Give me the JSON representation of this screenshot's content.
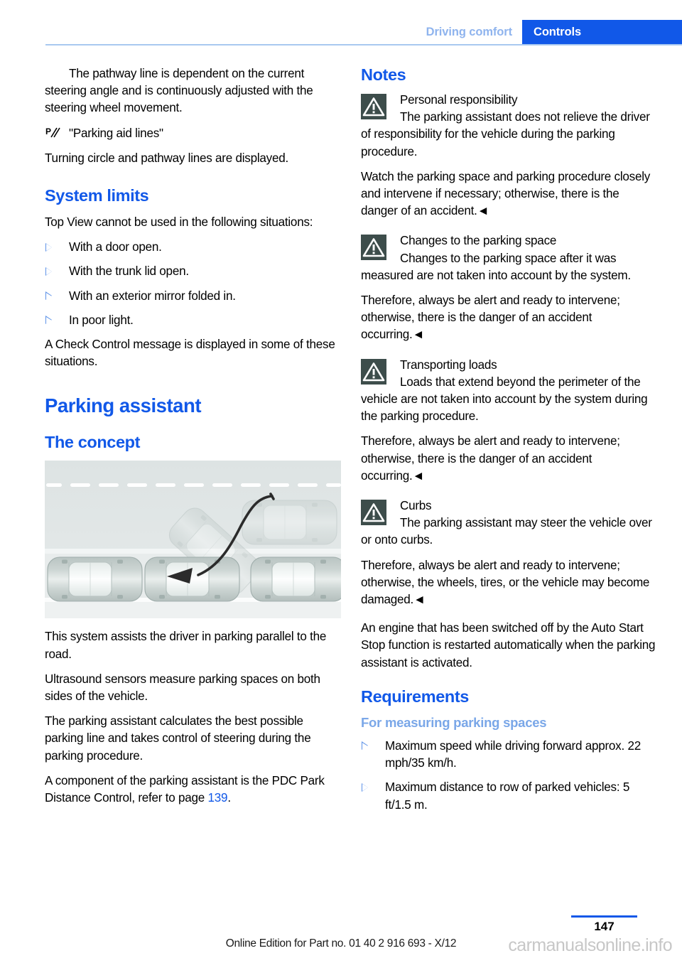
{
  "header": {
    "inactive_tab": "Driving comfort",
    "active_tab": "Controls"
  },
  "left_column": {
    "intro_paragraph": "The pathway line is dependent on the current steering angle and is continuously adjusted with the steering wheel movement.",
    "parking_aid_lines_label": "\"Parking aid lines\"",
    "parking_aid_lines_desc": "Turning circle and pathway lines are displayed.",
    "system_limits_heading": "System limits",
    "system_limits_intro": "Top View cannot be used in the following situations:",
    "system_limits_items": [
      "With a door open.",
      "With the trunk lid open.",
      "With an exterior mirror folded in.",
      "In poor light."
    ],
    "check_control_note": "A Check Control message is displayed in some of these situations.",
    "chapter_heading": "Parking assistant",
    "concept_heading": "The concept",
    "figure_caption_alt": "Top-down illustration of a vehicle parallel parking into a space between two parked cars",
    "paragraphs": [
      "This system assists the driver in parking parallel to the road.",
      "Ultrasound sensors measure parking spaces on both sides of the vehicle.",
      "The parking assistant calculates the best possible parking line and takes control of steering during the parking procedure."
    ],
    "pdc_sentence_before": "A component of the parking assistant is the PDC Park Distance Control, refer to page ",
    "pdc_page_link": "139",
    "pdc_sentence_after": "."
  },
  "right_column": {
    "notes_heading": "Notes",
    "notes": [
      {
        "icon": "warning-triangle-icon",
        "title": "Personal responsibility",
        "lead": "The parking assistant does not relieve the driver of responsibility for the vehicle during the parking procedure.",
        "follow": "Watch the parking space and parking procedure closely and intervene if necessary; otherwise, there is the danger of an accident.◄"
      },
      {
        "icon": "warning-triangle-icon",
        "title": "Changes to the parking space",
        "lead": "Changes to the parking space after it was measured are not taken into account by the system.",
        "follow": "Therefore, always be alert and ready to intervene; otherwise, there is the danger of an accident occurring.◄"
      },
      {
        "icon": "warning-triangle-icon",
        "title": "Transporting loads",
        "lead": "Loads that extend beyond the perimeter of the vehicle are not taken into account by the system during the parking procedure.",
        "follow": "Therefore, always be alert and ready to intervene; otherwise, there is the danger of an accident occurring.◄"
      },
      {
        "icon": "warning-triangle-icon",
        "title": "Curbs",
        "lead": "The parking assistant may steer the vehicle over or onto curbs.",
        "follow": "Therefore, always be alert and ready to intervene; otherwise, the wheels, tires, or the vehicle may become damaged.◄"
      }
    ],
    "auto_start_stop_paragraph": "An engine that has been switched off by the Auto Start Stop function is restarted automatically when the parking assistant is activated.",
    "requirements_heading": "Requirements",
    "measuring_heading": "For measuring parking spaces",
    "measuring_items": [
      "Maximum speed while driving forward approx. 22 mph/35 km/h.",
      "Maximum distance to row of parked vehicles: 5 ft/1.5 m."
    ]
  },
  "footer": {
    "page_number": "147",
    "edition_note": "Online Edition for Part no. 01 40 2 916 693 - X/12",
    "watermark": "carmanualsonline.info"
  },
  "colors": {
    "accent_blue": "#1158e8",
    "light_blue": "#8fb4ee",
    "subsection_blue": "#7aa7e8",
    "warn_icon_bg": "#3d4d4b",
    "road_gray": "#dfe4e4"
  }
}
